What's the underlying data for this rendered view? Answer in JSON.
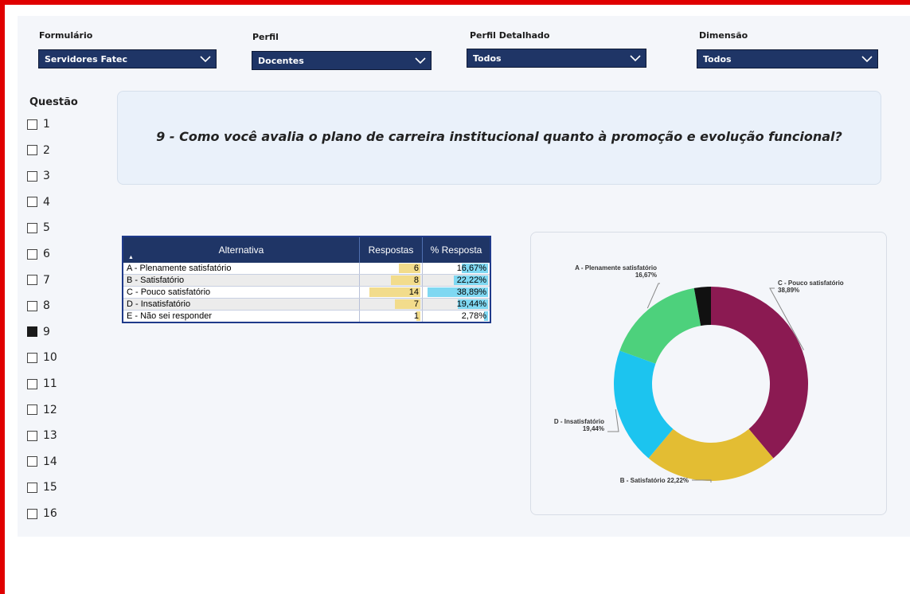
{
  "filters": [
    {
      "label": "Formulário",
      "value": "Servidores Fatec"
    },
    {
      "label": "Perfil",
      "value": "Docentes"
    },
    {
      "label": "Perfil Detalhado",
      "value": "Todos"
    },
    {
      "label": "Dimensão",
      "value": "Todos"
    }
  ],
  "questao": {
    "title": "Questão",
    "items": [
      "1",
      "2",
      "3",
      "4",
      "5",
      "6",
      "7",
      "8",
      "9",
      "10",
      "11",
      "12",
      "13",
      "14",
      "15",
      "16"
    ],
    "selected": "9"
  },
  "question_text": "9 - Como você avalia o plano de carreira institucional quanto à promoção e evolução funcional?",
  "table": {
    "headers": [
      "Alternativa",
      "Respostas",
      "% Resposta"
    ],
    "rows": [
      {
        "alternativa": "A - Plenamente satisfatório",
        "respostas": "6",
        "pct": "16,67%"
      },
      {
        "alternativa": "B - Satisfatório",
        "respostas": "8",
        "pct": "22,22%"
      },
      {
        "alternativa": "C - Pouco satisfatório",
        "respostas": "14",
        "pct": "38,89%"
      },
      {
        "alternativa": "D - Insatisfatório",
        "respostas": "7",
        "pct": "19,44%"
      },
      {
        "alternativa": "E - Não sei responder",
        "respostas": "1",
        "pct": "2,78%"
      }
    ]
  },
  "chart_data": {
    "type": "pie",
    "variant": "donut",
    "slices": [
      {
        "name": "C - Pouco satisfatório",
        "value": 38.89,
        "label": "C - Pouco satisfatório\n38,89%",
        "color": "#8b1a52"
      },
      {
        "name": "B - Satisfatório",
        "value": 22.22,
        "label": "B - Satisfatório 22,22%",
        "color": "#e3bd33"
      },
      {
        "name": "D - Insatisfatório",
        "value": 19.44,
        "label": "D - Insatisfatório\n19,44%",
        "color": "#1cc4ef"
      },
      {
        "name": "A - Plenamente satisfatório",
        "value": 16.67,
        "label": "A - Plenamente satisfatório\n16,67%",
        "color": "#4dd17c"
      },
      {
        "name": "E - Não sei responder",
        "value": 2.78,
        "label": "",
        "color": "#111111"
      }
    ]
  },
  "colors": {
    "header": "#1f3566",
    "frame": "#e00000",
    "resp_bar": "#f2dc8c",
    "pct_bar": "#7fd8f2"
  }
}
